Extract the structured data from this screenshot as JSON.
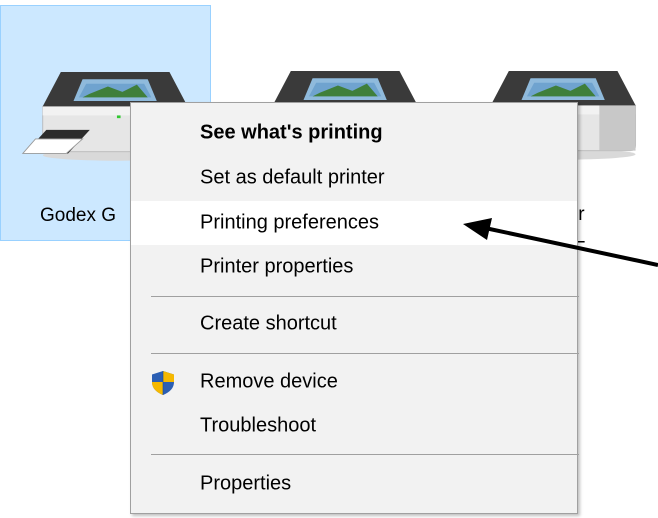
{
  "devices": [
    {
      "label": "Godex G",
      "selected": true
    },
    {
      "label": "",
      "selected": false
    },
    {
      "label": ": Pr",
      "label2": "F",
      "selected": false
    }
  ],
  "context_menu": {
    "items": [
      {
        "label": "See what's printing",
        "bold": true
      },
      {
        "label": "Set as default printer"
      },
      {
        "label": "Printing preferences",
        "highlighted": true
      },
      {
        "label": "Printer properties"
      },
      {
        "label": "Create shortcut"
      },
      {
        "label": "Remove device",
        "icon": "uac-shield-icon"
      },
      {
        "label": "Troubleshoot"
      },
      {
        "label": "Properties"
      }
    ]
  },
  "annotation": {
    "icon": "arrow-pointer-icon"
  },
  "colors": {
    "selection_bg": "#cce8ff",
    "selection_border": "#99d1ff",
    "menu_bg": "#f2f2f2",
    "hover_bg": "#ffffff"
  }
}
